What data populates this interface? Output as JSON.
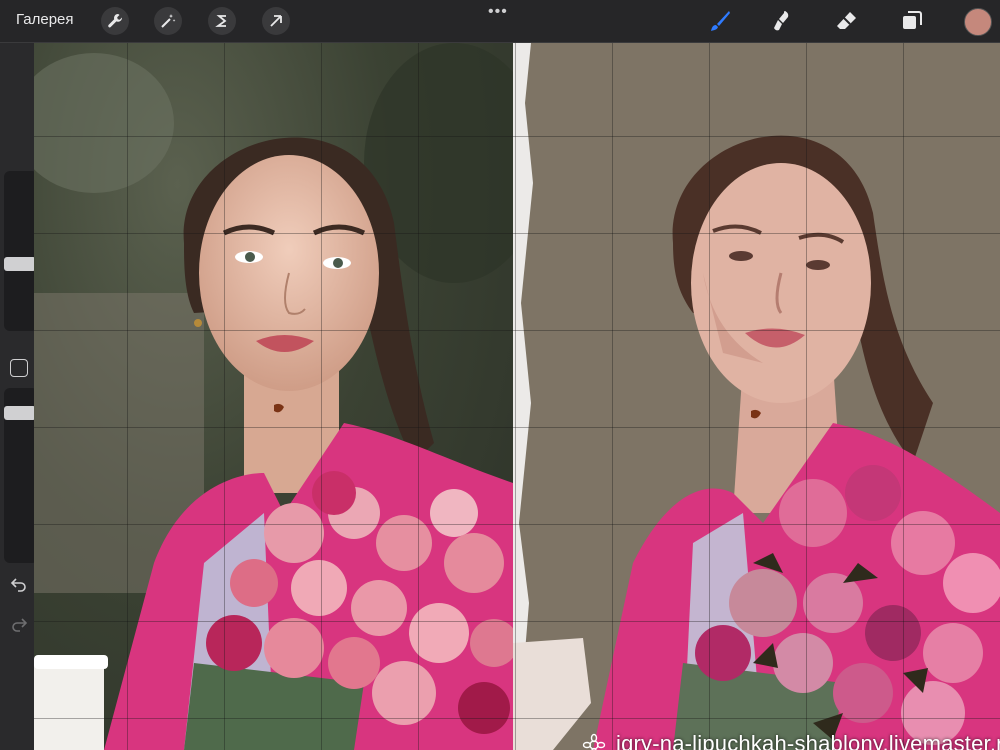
{
  "toolbar": {
    "gallery_label": "Галерея",
    "more_label": "•••",
    "left_tools": [
      "wrench-icon",
      "magic-wand-icon",
      "selection-s-icon",
      "arrow-move-icon"
    ],
    "right_tools": [
      "brush-icon",
      "smudge-icon",
      "eraser-icon",
      "layers-icon"
    ],
    "current_color": "#c5887c",
    "accent": "#2f7bff"
  },
  "sidebar": {
    "controls": [
      "brush-size-slider",
      "modify-square-button",
      "opacity-slider",
      "undo-icon",
      "redo-icon"
    ]
  },
  "canvas": {
    "photo_bg": "#3b4233",
    "painting_bg": "#7e7465",
    "coat_color": "#d8357f",
    "watermark": "igry-na-lipuchkah-shablony.livemaster.ru"
  }
}
